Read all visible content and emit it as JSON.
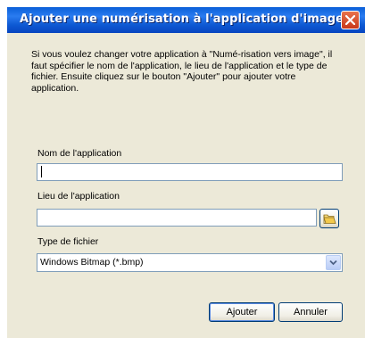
{
  "dialog": {
    "title": "Ajouter une numérisation à l'application d'image",
    "close_icon": "close-icon"
  },
  "intro_text": "Si vous voulez changer votre application à \"Numé-risation vers image\", il faut spécifier le nom de l'application, le lieu de l'application et le type de fichier. Ensuite cliquez sur le bouton \"Ajouter\" pour ajouter votre application.",
  "app_name": {
    "label": "Nom de l'application",
    "value": ""
  },
  "app_location": {
    "label": "Lieu de l'application",
    "value": "",
    "browse_icon": "folder-open-icon"
  },
  "file_type": {
    "label": "Type de fichier",
    "selected": "Windows Bitmap (*.bmp)"
  },
  "buttons": {
    "add": "Ajouter",
    "cancel": "Annuler"
  },
  "colors": {
    "titlebar": "#0a5fd8",
    "close_button": "#d8502c",
    "dialog_background": "#ece9d8",
    "field_border": "#7f9db9"
  }
}
